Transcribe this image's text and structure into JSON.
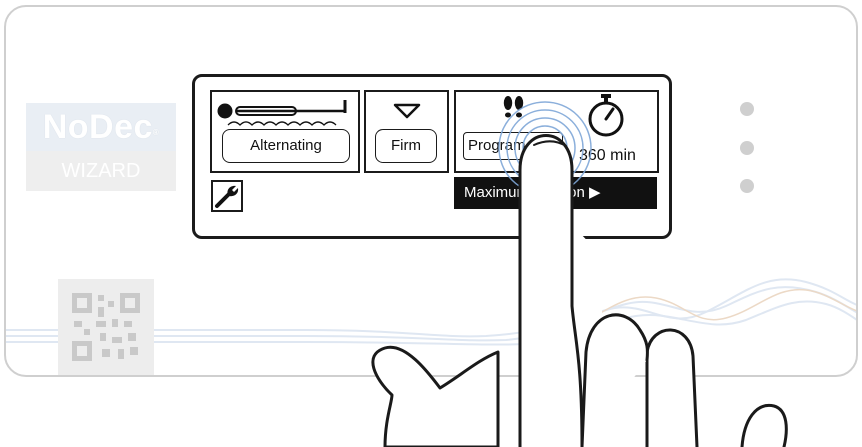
{
  "brand": {
    "name": "NoDec",
    "registered_mark": "®",
    "model": "WIZARD"
  },
  "screen": {
    "mode_label": "Alternating",
    "firmness_label": "Firm",
    "program_label": "Program",
    "timer_label": "360 min",
    "maximum_label": "Maximum inflation",
    "maximum_arrow": "▶"
  },
  "icons": {
    "mode": "mattress-alternating-icon",
    "firmness": "triangle-down-icon",
    "program": "footprints-icon",
    "timer": "stopwatch-icon",
    "settings": "wrench-icon",
    "qr": "qr-code-icon",
    "touch": "touching-finger-icon"
  },
  "colors": {
    "screen_border": "#1b1b1b",
    "led": "#cfcfcf",
    "brand_bg": "#e9eef4",
    "touch_ripple": "#7fa7d8"
  }
}
